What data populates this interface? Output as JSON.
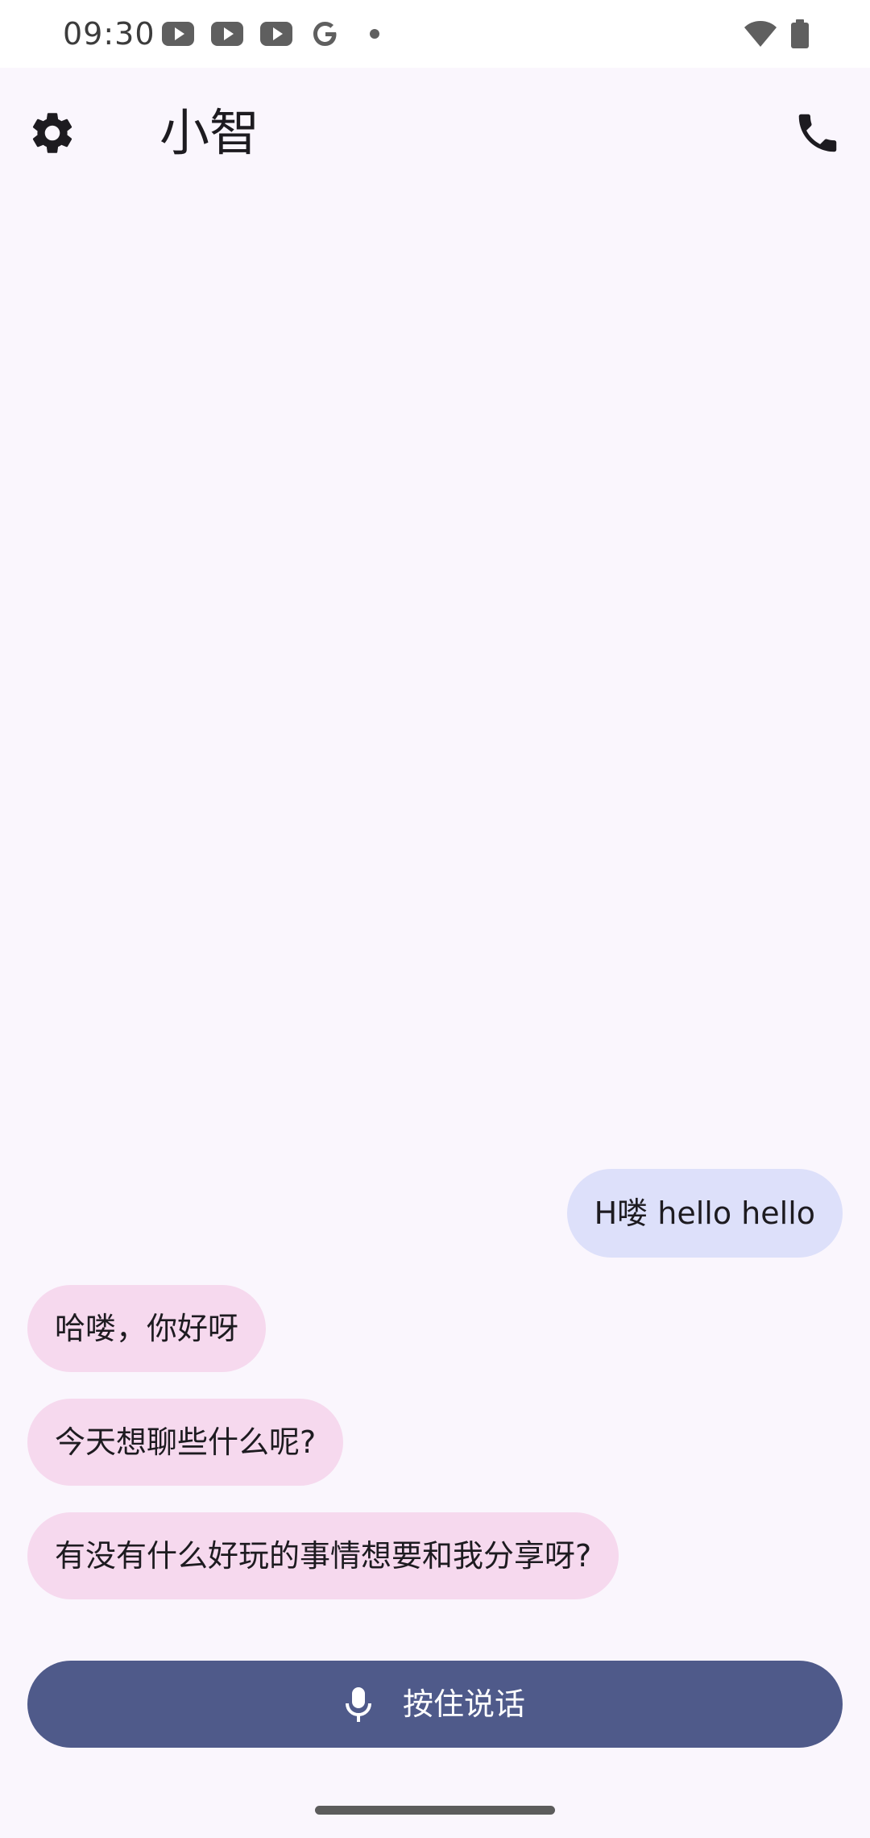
{
  "status_bar": {
    "time": "09:30",
    "notification_icons": [
      "youtube-icon",
      "youtube-icon",
      "youtube-icon",
      "google-icon",
      "dot-icon"
    ],
    "system_icons": [
      "wifi-icon",
      "battery-icon"
    ]
  },
  "app_bar": {
    "title": "小智",
    "left_icon": "settings-gear-icon",
    "right_icon": "phone-call-icon"
  },
  "messages": [
    {
      "role": "user",
      "text": "H喽 hello hello"
    },
    {
      "role": "assistant",
      "text": "哈喽，你好呀"
    },
    {
      "role": "assistant",
      "text": "今天想聊些什么呢?"
    },
    {
      "role": "assistant",
      "text": "有没有什么好玩的事情想要和我分享呀?"
    }
  ],
  "push_to_talk": {
    "label": "按住说话",
    "icon": "microphone-icon"
  },
  "colors": {
    "background": "#FAF6FD",
    "user_bubble": "#DDE0FA",
    "assistant_bubble": "#F6D9EE",
    "talk_button": "#4F5A8A"
  }
}
